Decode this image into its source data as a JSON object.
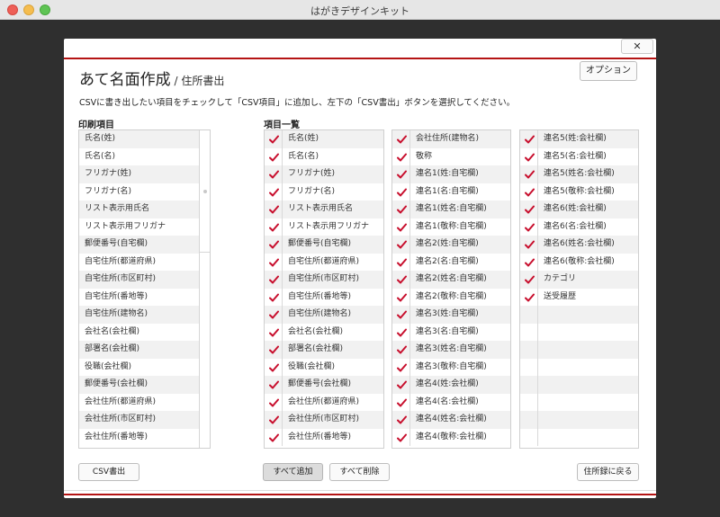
{
  "window": {
    "title": "はがきデザインキット"
  },
  "dialog": {
    "close_label": "✕",
    "title": "あて名面作成",
    "subtitle": " / 住所書出",
    "option_label": "オプション",
    "instruction": "CSVに書き出したい項目をチェックして「CSV項目」に追加し、左下の「CSV書出」ボタンを選択してください。",
    "print_items_label": "印刷項目",
    "item_list_label": "項目一覧",
    "print_items": [
      "氏名(姓)",
      "氏名(名)",
      "フリガナ(姓)",
      "フリガナ(名)",
      "リスト表示用氏名",
      "リスト表示用フリガナ",
      "郵便番号(自宅欄)",
      "自宅住所(都道府県)",
      "自宅住所(市区町村)",
      "自宅住所(番地等)",
      "自宅住所(建物名)",
      "会社名(会社欄)",
      "部署名(会社欄)",
      "役職(会社欄)",
      "郵便番号(会社欄)",
      "会社住所(都道府県)",
      "会社住所(市区町村)",
      "会社住所(番地等)"
    ],
    "item_col1": [
      "氏名(姓)",
      "氏名(名)",
      "フリガナ(姓)",
      "フリガナ(名)",
      "リスト表示用氏名",
      "リスト表示用フリガナ",
      "郵便番号(自宅欄)",
      "自宅住所(都道府県)",
      "自宅住所(市区町村)",
      "自宅住所(番地等)",
      "自宅住所(建物名)",
      "会社名(会社欄)",
      "部署名(会社欄)",
      "役職(会社欄)",
      "郵便番号(会社欄)",
      "会社住所(都道府県)",
      "会社住所(市区町村)",
      "会社住所(番地等)"
    ],
    "item_col2": [
      "会社住所(建物名)",
      "敬称",
      "連名1(姓:自宅欄)",
      "連名1(名:自宅欄)",
      "連名1(姓名:自宅欄)",
      "連名1(敬称:自宅欄)",
      "連名2(姓:自宅欄)",
      "連名2(名:自宅欄)",
      "連名2(姓名:自宅欄)",
      "連名2(敬称:自宅欄)",
      "連名3(姓:自宅欄)",
      "連名3(名:自宅欄)",
      "連名3(姓名:自宅欄)",
      "連名3(敬称:自宅欄)",
      "連名4(姓:会社欄)",
      "連名4(名:会社欄)",
      "連名4(姓名:会社欄)",
      "連名4(敬称:会社欄)"
    ],
    "item_col3": [
      "連名5(姓:会社欄)",
      "連名5(名:会社欄)",
      "連名5(姓名:会社欄)",
      "連名5(敬称:会社欄)",
      "連名6(姓:会社欄)",
      "連名6(名:会社欄)",
      "連名6(姓名:会社欄)",
      "連名6(敬称:会社欄)",
      "カテゴリ",
      "送受履歴",
      "",
      "",
      "",
      "",
      "",
      "",
      "",
      ""
    ],
    "col3_checked_count": 10,
    "check_color": "#c8102e",
    "buttons": {
      "csv_export": "CSV書出",
      "add_all": "すべて追加",
      "remove_all": "すべて削除",
      "back_to_address_book": "住所録に戻る"
    }
  }
}
